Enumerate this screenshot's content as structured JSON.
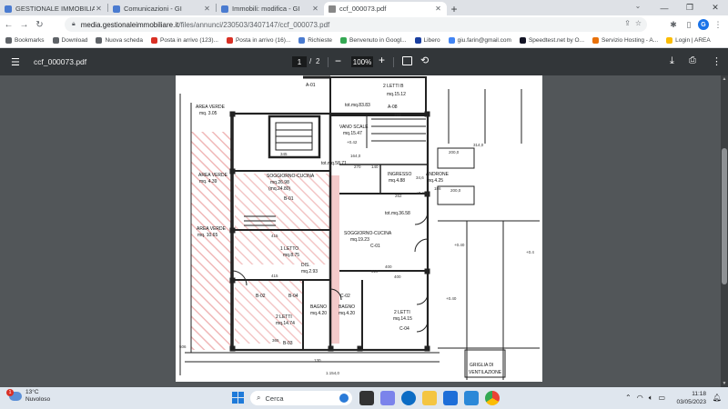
{
  "browser": {
    "tabs": [
      {
        "title": "GESTIONALE IMMOBILIARE - Mo"
      },
      {
        "title": "Comunicazioni - GI"
      },
      {
        "title": "Immobili: modifica - GI"
      },
      {
        "title": "ccf_000073.pdf",
        "active": true
      }
    ],
    "new_tab": "+",
    "url_host": "media.gestionaleimmobiliare.it",
    "url_path": "/files/annunci/230503/3407147/ccf_000073.pdf",
    "profile_initial": "G"
  },
  "bookmarks": [
    {
      "label": "Bookmarks",
      "icon": "bookmarks-icon",
      "color": "#5f6368"
    },
    {
      "label": "Download",
      "icon": "download-icon",
      "color": "#5f6368"
    },
    {
      "label": "Nuova scheda",
      "icon": "globe-icon",
      "color": "#5f6368"
    },
    {
      "label": "Posta in arrivo (123)...",
      "icon": "gmail-icon",
      "color": "#d93025"
    },
    {
      "label": "Posta in arrivo (16)...",
      "icon": "gmail-icon",
      "color": "#d93025"
    },
    {
      "label": "Richieste",
      "icon": "gi-icon",
      "color": "#4a7bd0"
    },
    {
      "label": "Benvenuto in Googl...",
      "icon": "chrome-icon",
      "color": "#34a853"
    },
    {
      "label": "Libero",
      "icon": "libero-icon",
      "color": "#1a3fa0"
    },
    {
      "label": "giu.farin@gmail.com",
      "icon": "google-icon",
      "color": "#4285f4"
    },
    {
      "label": "Speedtest.net by O...",
      "icon": "speedtest-icon",
      "color": "#141526"
    },
    {
      "label": "Servizio Hosting - A...",
      "icon": "aruba-icon",
      "color": "#e8710a"
    },
    {
      "label": "Login | AREA",
      "icon": "area-icon",
      "color": "#fbbc04"
    }
  ],
  "pdf": {
    "filename": "ccf_000073.pdf",
    "current_page": "1",
    "separator": "/",
    "total_pages": "2",
    "zoom": "100%"
  },
  "plan": {
    "labels": [
      {
        "t": "A-01"
      },
      {
        "t": "2 LETTI B"
      },
      {
        "t": "mq.15.12"
      },
      {
        "t": "A-08"
      },
      {
        "t": "tot.mq.83.83"
      },
      {
        "t": "AREA VERDE"
      },
      {
        "t": "mq. 3.05"
      },
      {
        "t": "VANO SCALE"
      },
      {
        "t": "mq.15.47"
      },
      {
        "t": "tot.mq.58.71"
      },
      {
        "t": "SOGGIORNO-CUCINA"
      },
      {
        "t": "mq.26.98"
      },
      {
        "t": "(mq.24.80)"
      },
      {
        "t": "INGRESSO"
      },
      {
        "t": "mq.4.88"
      },
      {
        "t": "ANDRONE"
      },
      {
        "t": "mq.4.25"
      },
      {
        "t": "AREA VERDE"
      },
      {
        "t": "mq. 4.39"
      },
      {
        "t": "AREA VERDE"
      },
      {
        "t": "mq. 10.65"
      },
      {
        "t": "tot.mq.36.58"
      },
      {
        "t": "SOGGIORNO-CUCINA"
      },
      {
        "t": "mq.19.23"
      },
      {
        "t": "C-01"
      },
      {
        "t": "B-01"
      },
      {
        "t": "1 LETTO"
      },
      {
        "t": "mq.8.75"
      },
      {
        "t": "DIS."
      },
      {
        "t": "mq.2.93"
      },
      {
        "t": "B-04"
      },
      {
        "t": "B-02"
      },
      {
        "t": "2 LETTI"
      },
      {
        "t": "mq.14.74"
      },
      {
        "t": "BAGNO"
      },
      {
        "t": "mq.4.20"
      },
      {
        "t": "BAGNO"
      },
      {
        "t": "mq.4.20"
      },
      {
        "t": "2 LETTI"
      },
      {
        "t": "mq.14.15"
      },
      {
        "t": "C-04"
      },
      {
        "t": "C-02"
      },
      {
        "t": "B-03"
      },
      {
        "t": "GRIGLIA DI"
      },
      {
        "t": "VENTILAZIONE"
      }
    ],
    "dims": [
      {
        "t": "365"
      },
      {
        "t": "415"
      },
      {
        "t": "415"
      },
      {
        "t": "400"
      },
      {
        "t": "400"
      },
      {
        "t": "510"
      },
      {
        "t": "164,0"
      },
      {
        "t": "200,0"
      },
      {
        "t": "200,0"
      },
      {
        "t": "270"
      },
      {
        "t": "140"
      },
      {
        "t": "262"
      },
      {
        "t": "345"
      },
      {
        "t": "365"
      },
      {
        "t": "130"
      },
      {
        "t": "1.154,0"
      },
      {
        "t": "+0.42"
      },
      {
        "t": "+0.40"
      },
      {
        "t": "+0.40"
      },
      {
        "t": "+0.40"
      },
      {
        "t": "+0.4"
      },
      {
        "t": "506"
      },
      {
        "t": "34,6"
      },
      {
        "t": "186"
      },
      {
        "t": "314,0"
      }
    ]
  },
  "taskbar": {
    "weather_temp": "13°C",
    "weather_desc": "Nuvoloso",
    "notif_count": "1",
    "search_placeholder": "Cerca",
    "time": "11:18",
    "date": "03/05/2023"
  }
}
